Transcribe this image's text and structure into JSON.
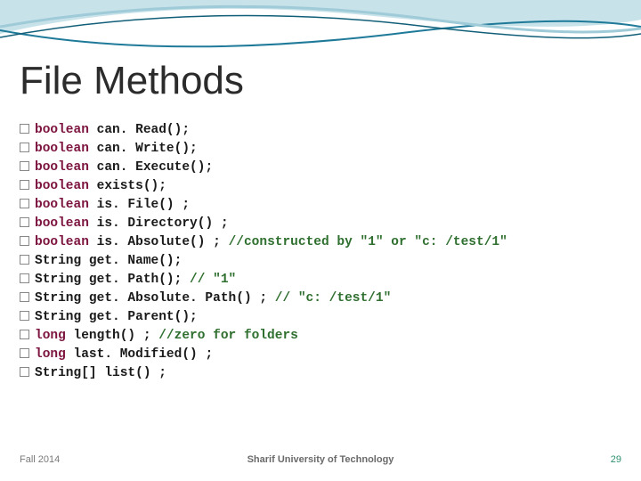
{
  "title": "File Methods",
  "code": {
    "lines": [
      {
        "kw": "boolean",
        "body": " can. Read();",
        "cm": ""
      },
      {
        "kw": "boolean",
        "body": " can. Write();",
        "cm": ""
      },
      {
        "kw": "boolean",
        "body": " can. Execute();",
        "cm": ""
      },
      {
        "kw": "boolean",
        "body": " exists();",
        "cm": ""
      },
      {
        "kw": "boolean",
        "body": " is. File() ;",
        "cm": ""
      },
      {
        "kw": "boolean",
        "body": " is. Directory() ;",
        "cm": ""
      },
      {
        "kw": "boolean",
        "body": " is. Absolute() ; ",
        "cm": "//constructed by \"1\" or \"c: /test/1\""
      },
      {
        "kw": "",
        "body": "String get. Name();",
        "cm": ""
      },
      {
        "kw": "",
        "body": "String get. Path(); ",
        "cm": "// \"1\""
      },
      {
        "kw": "",
        "body": "String get. Absolute. Path() ; ",
        "cm": "// \"c: /test/1\""
      },
      {
        "kw": "",
        "body": "String get. Parent();",
        "cm": ""
      },
      {
        "kw": "long",
        "body": " length() ; ",
        "cm": "//zero for folders"
      },
      {
        "kw": "long",
        "body": " last. Modified() ;",
        "cm": ""
      },
      {
        "kw": "",
        "body": "String[] list() ;",
        "cm": ""
      }
    ]
  },
  "footer": {
    "semester": "Fall 2014",
    "university": "Sharif University of Technology",
    "page": "29"
  },
  "colors": {
    "keyword": "#7c143f",
    "comment": "#2f6f2f",
    "swoosh1": "#9fcbd8",
    "swoosh2": "#1f7a99",
    "swoosh3": "#115e78"
  }
}
